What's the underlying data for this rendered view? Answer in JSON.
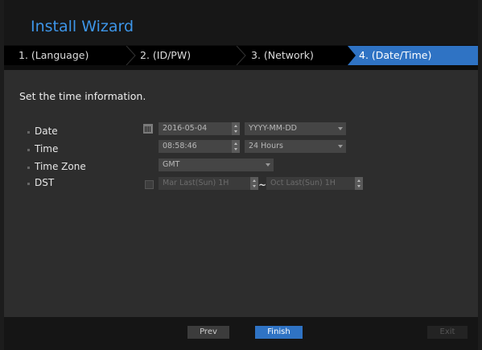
{
  "wizard": {
    "title": "Install Wizard"
  },
  "steps": [
    {
      "label": "1.  (Language)"
    },
    {
      "label": "2.  (ID/PW)"
    },
    {
      "label": "3.  (Network)"
    },
    {
      "label": "4.  (Date/Time)"
    }
  ],
  "content": {
    "heading": "Set the time information.",
    "date": {
      "label": "Date",
      "value": "2016-05-04",
      "format": "YYYY-MM-DD"
    },
    "time": {
      "label": "Time",
      "value": "08:58:46",
      "format": "24 Hours"
    },
    "timezone": {
      "label": "Time Zone",
      "value": "GMT"
    },
    "dst": {
      "label": "DST",
      "start": "Mar Last(Sun) 1H",
      "end": "Oct Last(Sun) 1H",
      "tilde": "~"
    }
  },
  "footer": {
    "prev": "Prev",
    "finish": "Finish",
    "exit": "Exit"
  },
  "colors": {
    "accent": "#2f73c4",
    "title": "#3d95e8"
  }
}
